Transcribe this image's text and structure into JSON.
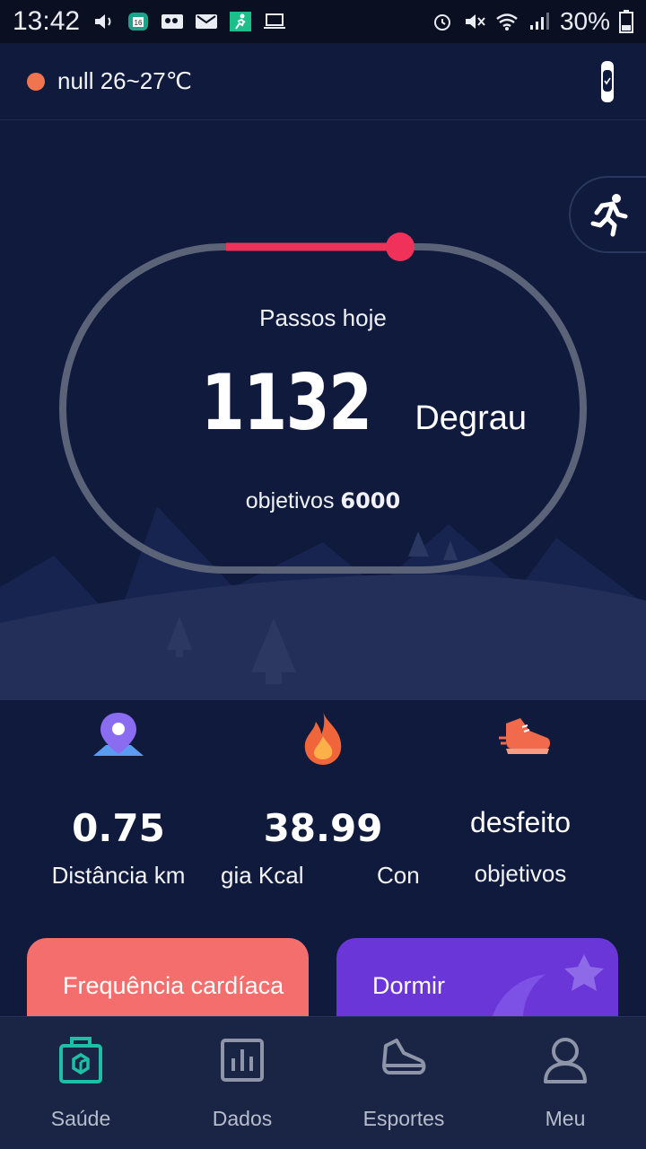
{
  "status_bar": {
    "time": "13:42",
    "battery": "30%",
    "left_icons": [
      "volume-icon",
      "calendar-icon",
      "voicemail-icon",
      "mail-icon",
      "fitness-app-icon",
      "laptop-icon"
    ],
    "right_icons": [
      "alarm-icon",
      "mute-icon",
      "wifi-icon",
      "signal-icon",
      "battery-icon"
    ]
  },
  "header": {
    "weather_text": "null 26~27℃",
    "weather_dot_color": "#f0744e",
    "device_icon": "band-icon"
  },
  "hero": {
    "label": "Passos hoje",
    "steps": "1132",
    "unit": "Degrau",
    "goal_label": "objetivos",
    "goal_value": "6000",
    "progress_color": "#f0325a",
    "run_button_icon": "running-icon"
  },
  "stats": [
    {
      "icon": "location-pin-icon",
      "value": "0.75",
      "label": "Distância km"
    },
    {
      "icon": "flame-icon",
      "value": "38.99",
      "label": "gia Kcal"
    },
    {
      "icon": "sneaker-icon",
      "value": "desfeito",
      "label": "objetivos",
      "partial_label": "Con"
    }
  ],
  "cards": [
    {
      "title": "Frequência cardíaca",
      "color": "#f56e6e"
    },
    {
      "title": "Dormir",
      "color": "#6b36d8"
    }
  ],
  "nav": [
    {
      "label": "Saúde",
      "icon": "health-icon",
      "active": true
    },
    {
      "label": "Dados",
      "icon": "chart-icon",
      "active": false
    },
    {
      "label": "Esportes",
      "icon": "sports-shoe-icon",
      "active": false
    },
    {
      "label": "Meu",
      "icon": "profile-icon",
      "active": false
    }
  ]
}
